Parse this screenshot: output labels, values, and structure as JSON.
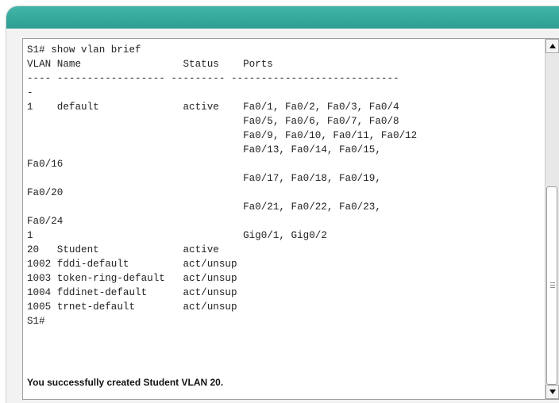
{
  "terminal": {
    "lines": [
      "S1# show vlan brief",
      "VLAN Name                 Status    Ports",
      "---- ------------------ --------- ----------------------------",
      "-",
      "1    default              active    Fa0/1, Fa0/2, Fa0/3, Fa0/4",
      "                                    Fa0/5, Fa0/6, Fa0/7, Fa0/8",
      "                                    Fa0/9, Fa0/10, Fa0/11, Fa0/12",
      "                                    Fa0/13, Fa0/14, Fa0/15,",
      "Fa0/16",
      "                                    Fa0/17, Fa0/18, Fa0/19,",
      "Fa0/20",
      "                                    Fa0/21, Fa0/22, Fa0/23,",
      "Fa0/24",
      "1                                   Gig0/1, Gig0/2",
      "20   Student              active",
      "1002 fddi-default         act/unsup",
      "1003 token-ring-default   act/unsup",
      "1004 fddinet-default      act/unsup",
      "1005 trnet-default        act/unsup",
      "S1#"
    ],
    "status_message": "You successfully created Student VLAN 20."
  },
  "scrollbar": {
    "up_icon": "triangle-up-icon",
    "down_icon": "triangle-down-icon",
    "grip_icon": "grip-lines-icon"
  },
  "colors": {
    "titlebar": "#34a99c",
    "panel_background": "#ffffff",
    "text": "#222222"
  }
}
